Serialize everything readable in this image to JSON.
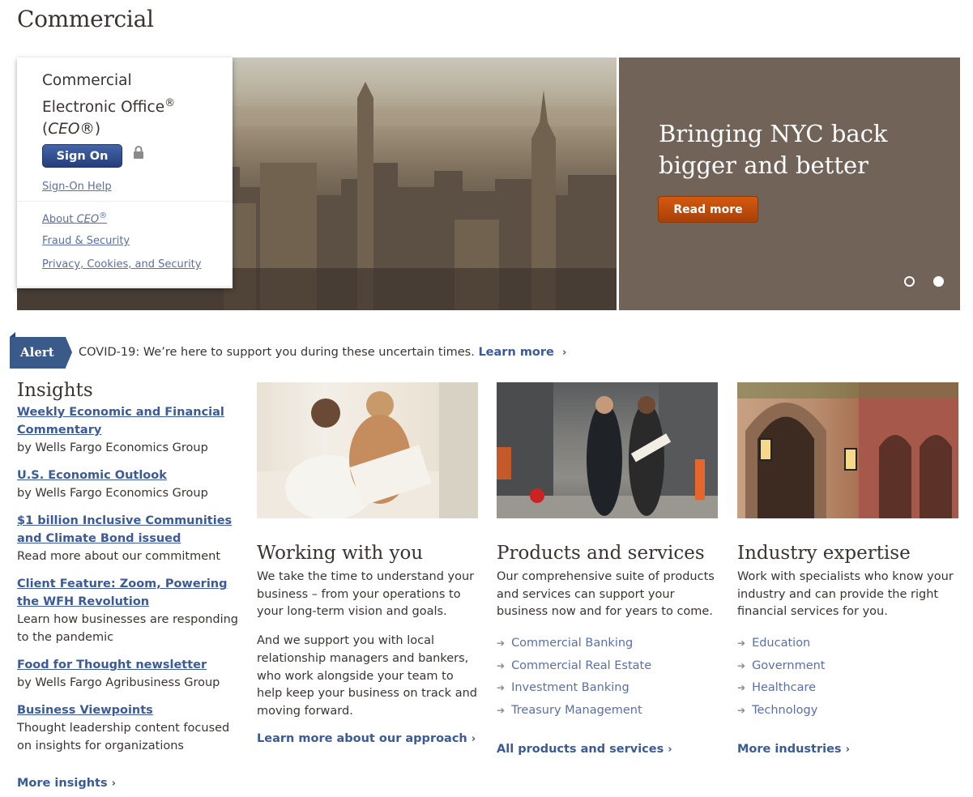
{
  "page": {
    "title": "Commercial"
  },
  "signon": {
    "title_line1": "Commercial",
    "title_line2": "Electronic Office",
    "title_reg": "®",
    "title_line3_pre": "(",
    "title_line3_em": "CEO",
    "title_line3_post": "®)",
    "button_label": "Sign On",
    "help_link": "Sign-On Help",
    "about_pre": "About ",
    "about_em": "CEO",
    "about_sup": "®",
    "fraud_link": "Fraud & Security",
    "privacy_link": "Privacy, Cookies, and Security"
  },
  "hero": {
    "headline": "Bringing NYC back bigger and better",
    "button_label": "Read more"
  },
  "alert": {
    "badge": "Alert",
    "text": "COVID-19: We’re here to support you during these uncertain times.",
    "link": "Learn more",
    "link_chevron": "›"
  },
  "insights": {
    "title": "Insights",
    "items": [
      {
        "title": "Weekly Economic and Financial Commentary",
        "desc": "by Wells Fargo Economics Group"
      },
      {
        "title": "U.S. Economic Outlook",
        "desc": "by Wells Fargo Economics Group"
      },
      {
        "title": "$1 billion Inclusive Communities and Climate Bond issued",
        "desc": "Read more about our commitment"
      },
      {
        "title": "Client Feature: Zoom, Powering the WFH Revolution",
        "desc": "Learn how businesses are responding to the pandemic"
      },
      {
        "title": "Food for Thought newsletter",
        "desc": "by Wells Fargo Agribusiness Group"
      },
      {
        "title": "Business Viewpoints",
        "desc": "Thought leadership content focused on insights for organizations"
      }
    ],
    "more": "More insights",
    "more_chevron": "›"
  },
  "working": {
    "title": "Working with you",
    "para1": "We take the time to understand your business – from your operations to your long-term vision and goals.",
    "para2": "And we support you with local relationship managers and bankers, who work alongside your team to help keep your business on track and moving forward.",
    "more": "Learn more about our approach",
    "chevron": "›"
  },
  "products": {
    "title": "Products and services",
    "para": "Our comprehensive suite of products and services can support your business now and for years to come.",
    "items": [
      "Commercial Banking",
      "Commercial Real Estate",
      "Investment Banking",
      "Treasury Management"
    ],
    "arrow": "➔",
    "more": "All products and services",
    "chevron": "›"
  },
  "industry": {
    "title": "Industry expertise",
    "para": "Work with specialists who know your industry and can provide the right financial services for you.",
    "items": [
      "Education",
      "Government",
      "Healthcare",
      "Technology"
    ],
    "arrow": "➔",
    "more": "More industries",
    "chevron": "›"
  }
}
